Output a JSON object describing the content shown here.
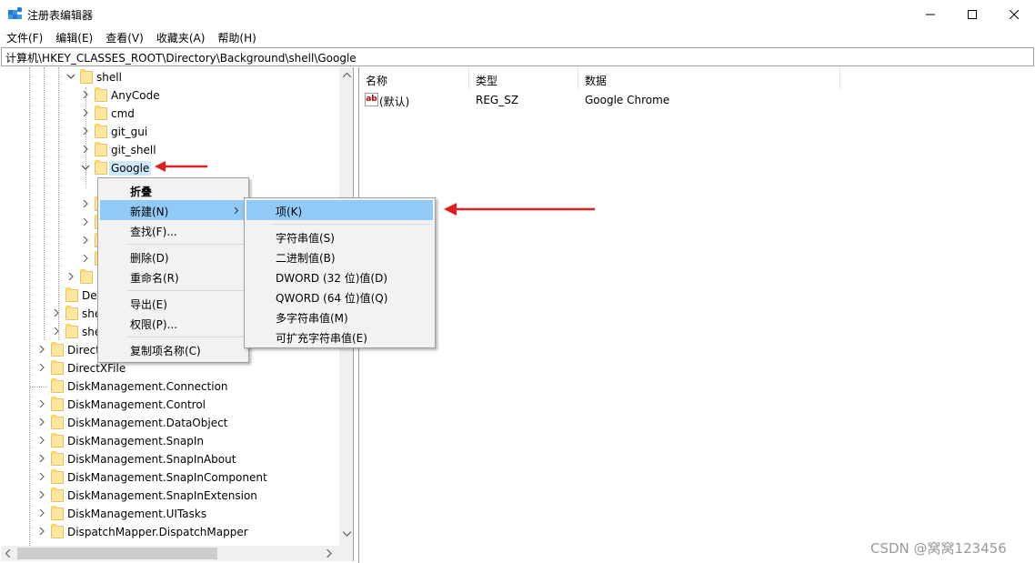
{
  "window": {
    "title": "注册表编辑器"
  },
  "menu": [
    "文件(F)",
    "编辑(E)",
    "查看(V)",
    "收藏夹(A)",
    "帮助(H)"
  ],
  "address": "计算机\\HKEY_CLASSES_ROOT\\Directory\\Background\\shell\\Google",
  "tree": {
    "shell": "shell",
    "shell_children": [
      "AnyCode",
      "cmd",
      "git_gui",
      "git_shell",
      "Google"
    ],
    "partial": [
      "De",
      "she",
      "she",
      "Direct"
    ],
    "bottom": [
      "DirectXFile",
      "DiskManagement.Connection",
      "DiskManagement.Control",
      "DiskManagement.DataObject",
      "DiskManagement.SnapIn",
      "DiskManagement.SnapInAbout",
      "DiskManagement.SnapInComponent",
      "DiskManagement.SnapInExtension",
      "DiskManagement.UITasks",
      "DispatchMapper.DispatchMapper"
    ]
  },
  "list": {
    "headers": [
      "名称",
      "类型",
      "数据"
    ],
    "rows": [
      {
        "name": "(默认)",
        "type": "REG_SZ",
        "data": "Google Chrome"
      }
    ]
  },
  "context_menu": {
    "items": [
      "折叠",
      "新建(N)",
      "查找(F)...",
      "删除(D)",
      "重命名(R)",
      "导出(E)",
      "权限(P)...",
      "复制项名称(C)"
    ]
  },
  "submenu": {
    "items": [
      "项(K)",
      "字符串值(S)",
      "二进制值(B)",
      "DWORD (32 位)值(D)",
      "QWORD (64 位)值(Q)",
      "多字符串值(M)",
      "可扩充字符串值(E)"
    ]
  },
  "colors": {
    "arrow": "#e02020",
    "highlight": "#91c9f7",
    "selection": "#cce8ff"
  },
  "watermark": "CSDN @窝窝123456"
}
